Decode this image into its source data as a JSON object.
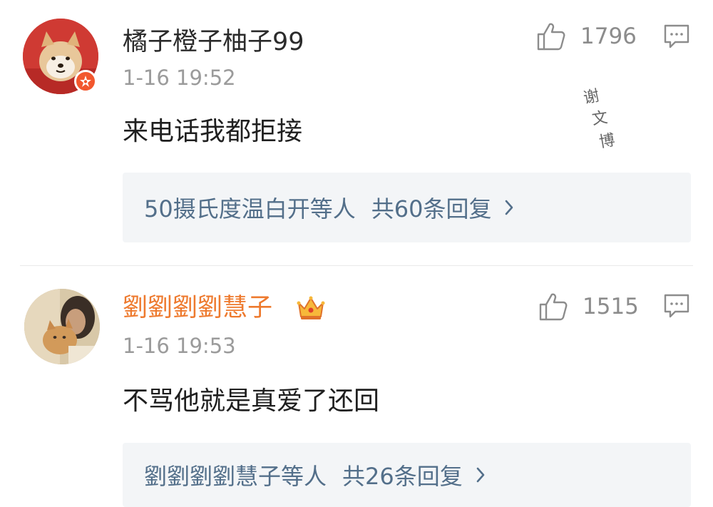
{
  "comments": [
    {
      "username": "橘子橙子柚子99",
      "timestamp": "1-16 19:52",
      "likes": "1796",
      "text": "来电话我都拒接",
      "replies_from": "50摄氏度温白开等人",
      "replies_count": "共60条回复",
      "username_color": "#2b2b2b",
      "avatar": "shiba-dog-avatar",
      "badge": "vip-badge-icon"
    },
    {
      "username": "劉劉劉劉慧子",
      "timestamp": "1-16 19:53",
      "likes": "1515",
      "text": "不骂他就是真爱了还回",
      "replies_from": "劉劉劉劉慧子等人",
      "replies_count": "共26条回复",
      "username_color": "#ee7a2e",
      "avatar": "girl-with-cat-avatar",
      "badge": "crown-icon"
    }
  ],
  "watermark": "谢文博",
  "colors": {
    "link": "#536f8a",
    "muted": "#9b9b9b",
    "reply_box_bg": "#f3f5f7",
    "vip": "#f2572e"
  }
}
